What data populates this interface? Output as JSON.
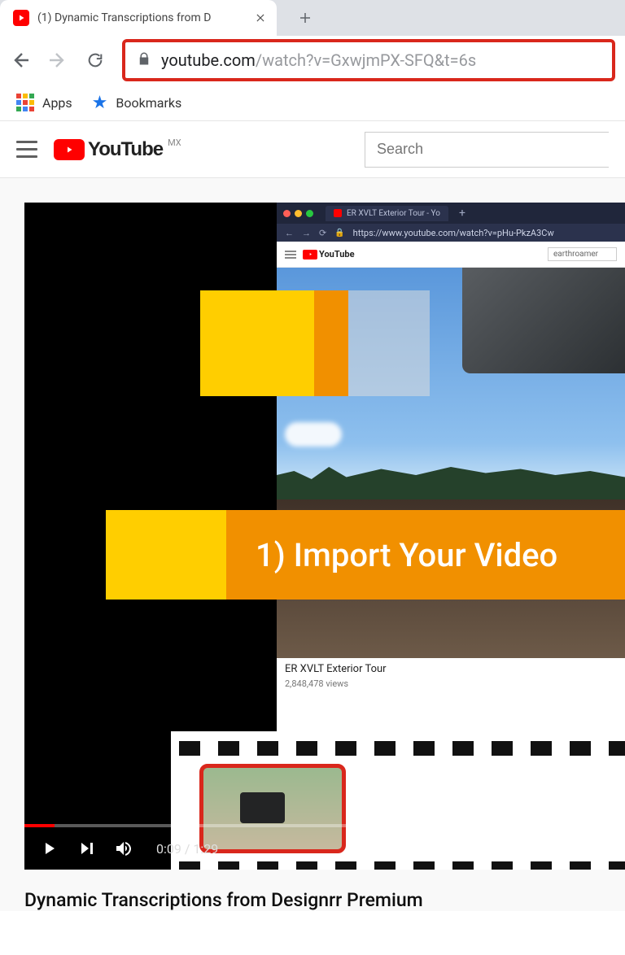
{
  "browser": {
    "tab_title": "(1) Dynamic Transcriptions from D",
    "url_host": "youtube.com",
    "url_path": "/watch?v=GxwjmPX-SFQ&t=6s",
    "apps_label": "Apps",
    "bookmarks_label": "Bookmarks"
  },
  "youtube": {
    "brand": "YouTube",
    "country": "MX",
    "search_placeholder": "Search"
  },
  "player": {
    "inner_tab_title": "ER XVLT Exterior Tour - Yo",
    "inner_url": "https://www.youtube.com/watch?v=pHu-PkzA3Cw",
    "inner_brand": "YouTube",
    "inner_search_value": "earthroamer",
    "inner_video_title": "ER XVLT Exterior Tour",
    "inner_video_views": "2,848,478 views",
    "banner_text": "1) Import Your Video",
    "current_time": "0:09",
    "duration": "1:29"
  },
  "page": {
    "video_title": "Dynamic Transcriptions from Designrr Premium"
  }
}
